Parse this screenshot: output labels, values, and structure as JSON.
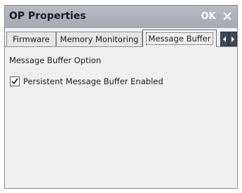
{
  "window": {
    "title": "OP Properties",
    "ok_label": "OK",
    "close_icon": "close-icon"
  },
  "tabs": [
    {
      "label": "Firmware",
      "active": false
    },
    {
      "label": "Memory Monitoring",
      "active": false
    },
    {
      "label": "Message Buffer",
      "active": true
    }
  ],
  "tab_scroll": {
    "left_icon": "chevron-left-icon",
    "right_icon": "chevron-right-icon"
  },
  "panel": {
    "section_label": "Message Buffer Option",
    "checkbox": {
      "label": "Persistent Message Buffer Enabled",
      "checked": true
    }
  },
  "colors": {
    "titlebar": "#a8adb5",
    "window_bg": "#f0f0f0",
    "tab_scroll_bg": "#3f4a58"
  }
}
